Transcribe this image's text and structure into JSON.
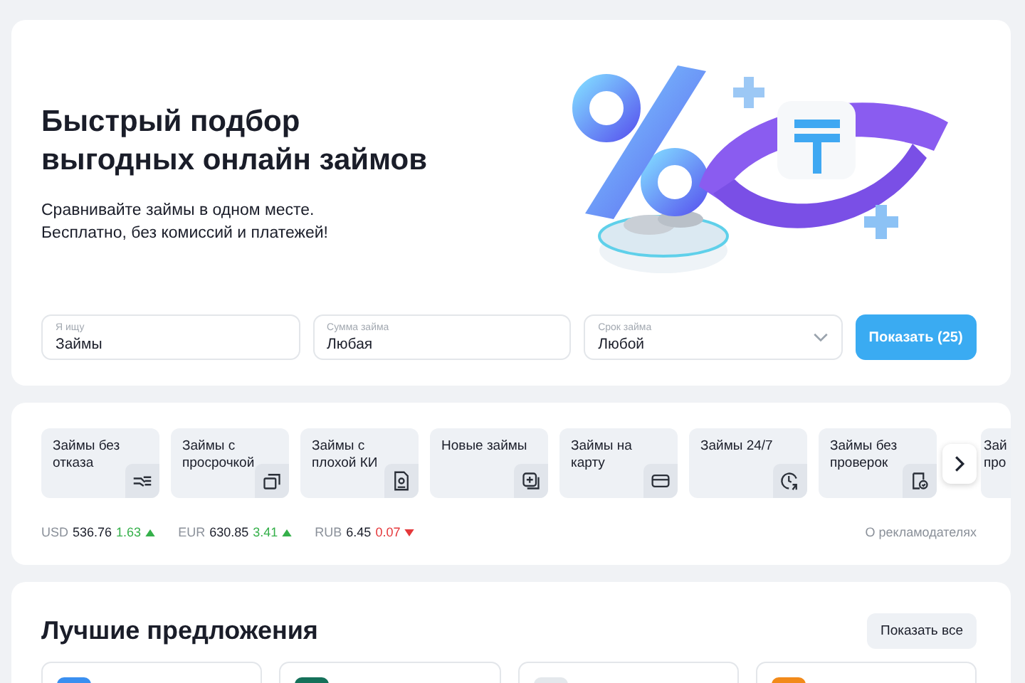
{
  "hero": {
    "title": "Быстрый подбор выгодных онлайн займов",
    "subtitle_lines": [
      "Сравнивайте займы в одном месте.",
      "Бесплатно, без комиссий и платежей!"
    ],
    "fields": [
      {
        "kind": "input",
        "label": "Я ищу",
        "value": "Займы"
      },
      {
        "kind": "input",
        "label": "Сумма займа",
        "value": "Любая"
      },
      {
        "kind": "select",
        "label": "Срок займа",
        "value": "Любой"
      }
    ],
    "submit": "Показать (25)"
  },
  "categories": {
    "items": [
      {
        "label": "Займы без отказа"
      },
      {
        "label": "Займы с просрочкой"
      },
      {
        "label": "Займы с плохой КИ"
      },
      {
        "label": "Новые займы"
      },
      {
        "label": "Займы на карту"
      },
      {
        "label": "Займы 24/7"
      },
      {
        "label": "Займы без проверок"
      }
    ],
    "partial_item": {
      "label": "Зай про"
    },
    "rates": [
      {
        "code": "USD",
        "value": "536.76",
        "change": "1.63",
        "rising": true
      },
      {
        "code": "EUR",
        "value": "630.85",
        "change": "3.41",
        "rising": true
      },
      {
        "code": "RUB",
        "value": "6.45",
        "change": "0.07",
        "rising": false
      }
    ],
    "advertisers_link": "О рекламодателях"
  },
  "offers": {
    "title": "Лучшие предложения",
    "show_all": "Показать все",
    "cards": [
      {
        "color": "#3a8ff0"
      },
      {
        "color": "#15715a"
      },
      {
        "color": "#e4e8ec"
      },
      {
        "color": "#f28a1a"
      }
    ]
  }
}
